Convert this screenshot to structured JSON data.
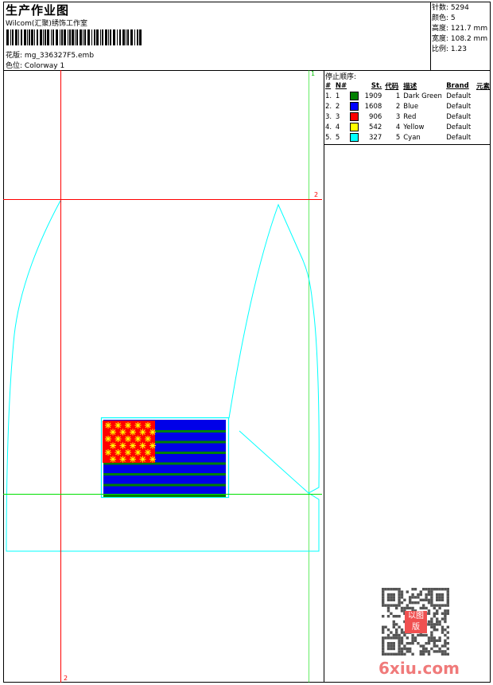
{
  "header": {
    "title": "生产作业图",
    "company": "Wilcom(汇聚)绣饰工作室",
    "design_label": "花版:",
    "design_value": "mg_336327F5.emb",
    "colorway_label": "色位:",
    "colorway_value": "Colorway 1"
  },
  "stats": [
    {
      "label": "针数:",
      "value": "5294"
    },
    {
      "label": "颜色:",
      "value": "5"
    },
    {
      "label": "高度:",
      "value": "121.7 mm"
    },
    {
      "label": "宽度:",
      "value": "108.2 mm"
    },
    {
      "label": "比例:",
      "value": "1.23"
    }
  ],
  "stop_sequence": {
    "title": "停止顺序:",
    "columns": [
      "#",
      "N#",
      "St.",
      "代码",
      "描述",
      "Brand",
      "元素"
    ],
    "rows": [
      {
        "idx": "1.",
        "n": "1",
        "color": "#008000",
        "st": "1909",
        "code": "1",
        "desc": "Dark Green",
        "brand": "Default"
      },
      {
        "idx": "2.",
        "n": "2",
        "color": "#0000ff",
        "st": "1608",
        "code": "2",
        "desc": "Blue",
        "brand": "Default"
      },
      {
        "idx": "3.",
        "n": "3",
        "color": "#ff0000",
        "st": "906",
        "code": "3",
        "desc": "Red",
        "brand": "Default"
      },
      {
        "idx": "4.",
        "n": "4",
        "color": "#ffff00",
        "st": "542",
        "code": "4",
        "desc": "Yellow",
        "brand": "Default"
      },
      {
        "idx": "5.",
        "n": "5",
        "color": "#00ffff",
        "st": "327",
        "code": "5",
        "desc": "Cyan",
        "brand": "Default"
      }
    ]
  },
  "canvas": {
    "markers": {
      "top_right": "1",
      "red_h": "2",
      "red_v": "2"
    },
    "colors": {
      "red_guide": "#ff0000",
      "green_guide": "#00e000",
      "outline": "#00ffff"
    }
  },
  "watermark": {
    "text": "6xiu.com",
    "seal": "以图版"
  }
}
